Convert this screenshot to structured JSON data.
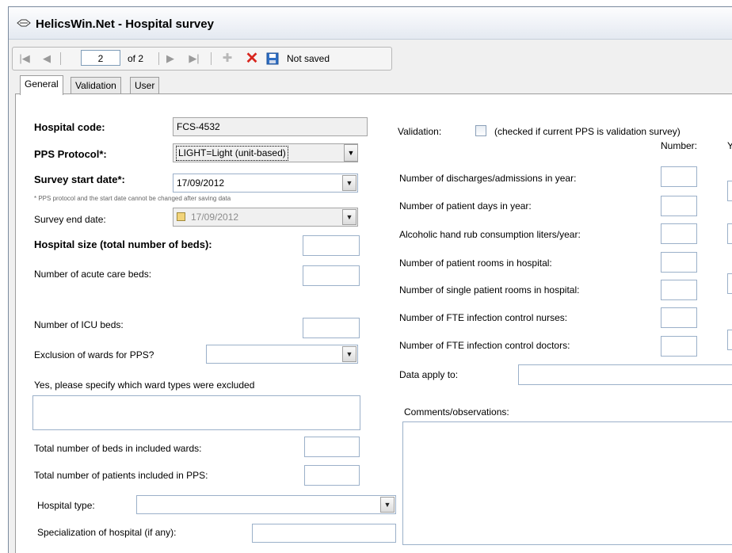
{
  "window": {
    "title": "HelicsWin.Net - Hospital survey"
  },
  "toolbar": {
    "first": "|◀",
    "prev": "◀",
    "page_value": "2",
    "page_of": "of 2",
    "next": "▶",
    "last": "▶|",
    "add": "✚",
    "delete": "✕",
    "save": "💾",
    "status": "Not saved"
  },
  "tabs": [
    "General",
    "Validation",
    "User"
  ],
  "left": {
    "hospital_code_label": "Hospital code:",
    "hospital_code_value": "FCS-4532",
    "pps_protocol_label": "PPS Protocol*:",
    "pps_protocol_value": "LIGHT=Light (unit-based)",
    "survey_start_label": "Survey start date*:",
    "survey_start_value": "17/09/2012",
    "hint": "* PPS protocol and the start date cannot be changed after saving data",
    "survey_end_label": "Survey end date:",
    "survey_end_value": "17/09/2012",
    "hospital_size_label": "Hospital size (total number of beds):",
    "acute_beds_label": "Number of acute care beds:",
    "icu_beds_label": "Number of ICU beds:",
    "exclusion_label": "Exclusion of wards for PPS?",
    "excluded_label": "Yes, please specify which ward types were excluded",
    "total_beds_label": "Total number of beds in included wards:",
    "total_patients_label": "Total number of patients included in PPS:",
    "hospital_type_label": "Hospital type:",
    "specialization_label": "Specialization of hospital (if any):"
  },
  "right": {
    "validation_label": "Validation:",
    "validation_desc": "(checked if current PPS is validation survey)",
    "number_header": "Number:",
    "year_header": "Y",
    "discharges_label": "Number of discharges/admissions in year:",
    "patient_days_label": "Number of patient days in year:",
    "alcoholic_label": "Alcoholic hand rub consumption liters/year:",
    "rooms_label": "Number of patient rooms in hospital:",
    "single_rooms_label": "Number of single patient rooms in hospital:",
    "fte_nurses_label": "Number of FTE infection control nurses:",
    "fte_doctors_label": "Number of FTE infection control doctors:",
    "data_apply_label": "Data apply to:",
    "comments_label": "Comments/observations:"
  },
  "colors": {
    "titlebar_top": "#fdfdfe",
    "titlebar_bottom": "#e4e9f1",
    "delete_red": "#d8261e",
    "add_gray": "#b8b8b8",
    "save_blue": "#2f6fc5"
  }
}
